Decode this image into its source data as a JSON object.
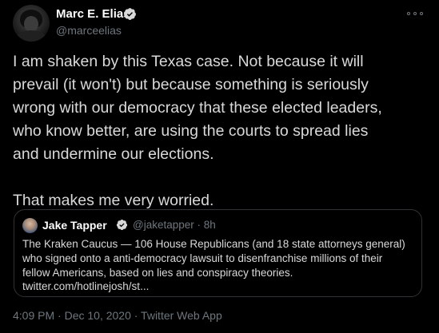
{
  "author": {
    "name": "Marc E. Elias",
    "handle": "@marceelias"
  },
  "tweet": {
    "lines": [
      "I am shaken by this Texas case. Not because it will",
      "prevail (it won't) but because something is seriously",
      "wrong with our democracy that these elected leaders,",
      "who know better, are using the courts to spread lies",
      "and undermine our elections."
    ],
    "second_paragraph": "That makes me very worried."
  },
  "quoted_tweet": {
    "name": "Jake Tapper",
    "handle_time": "@jaketapper · 8h",
    "lines": [
      "The Kraken Caucus — 106 House Republicans (and 18 state attorneys general)",
      "who signed onto a anti-democracy lawsuit to disenfranchise millions of their",
      "fellow Americans, based on lies and conspiracy theories.",
      "twitter.com/hotlinejosh/st..."
    ]
  },
  "footer": {
    "meta": "4:09 PM · Dec 10, 2020 · Twitter Web App"
  },
  "icons": {
    "verified": "verified-badge-icon",
    "more": "more-options-icon"
  },
  "colors": {
    "background": "#000000",
    "text": "#d9d9d9",
    "muted": "#6e767d",
    "border": "#2f3336",
    "verified_blue": "#1da1f2"
  }
}
